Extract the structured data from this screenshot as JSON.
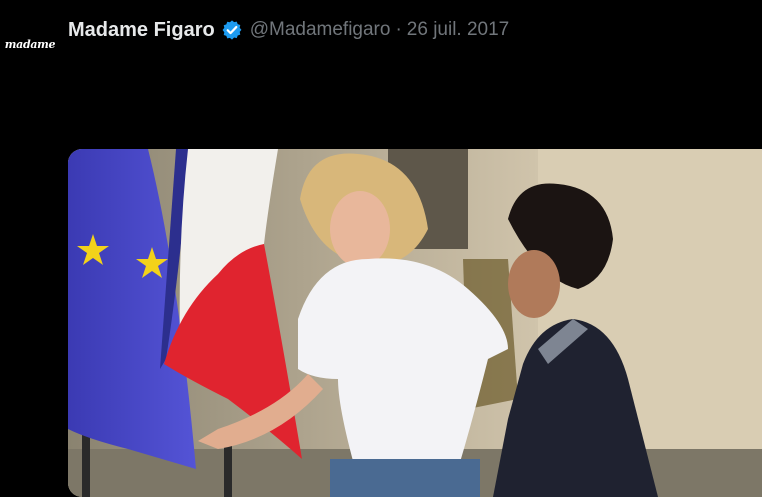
{
  "avatar": {
    "text": "madame",
    "icon": "madame-figaro-logo"
  },
  "tweet": {
    "author_name": "Madame Figaro",
    "verified_icon": "verified-badge-icon",
    "handle": "@Madamefigaro",
    "separator": "·",
    "date": "26 juil. 2017",
    "media_alt_icon": "tweet-photo"
  },
  "colors": {
    "background": "#000000",
    "name": "#e7e9ea",
    "muted": "#71767b",
    "verified": "#1d9bf0"
  }
}
